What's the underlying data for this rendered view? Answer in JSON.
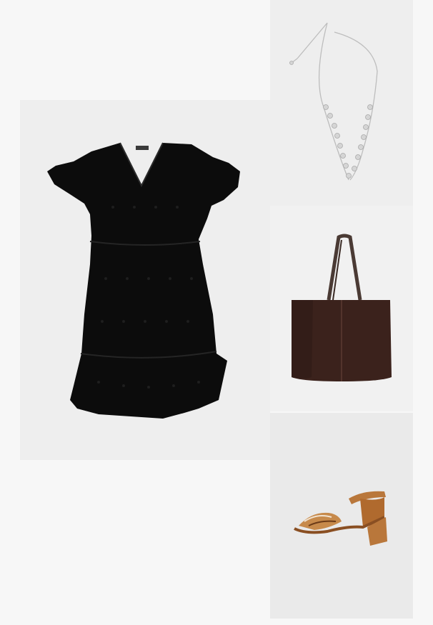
{
  "outfit": {
    "items": [
      {
        "id": "dress",
        "icon": "black-eyelet-tiered-dress",
        "color": "#0c0c0c"
      },
      {
        "id": "necklace",
        "icon": "silver-floral-necklace",
        "color": "#c9c9c9"
      },
      {
        "id": "bag",
        "icon": "brown-suede-tote-bag",
        "color": "#3b221c"
      },
      {
        "id": "sandal",
        "icon": "tan-block-heel-sandal",
        "color": "#b9773b"
      }
    ],
    "background_color": "#f7f7f7",
    "tile_color": "#eeeeee"
  }
}
